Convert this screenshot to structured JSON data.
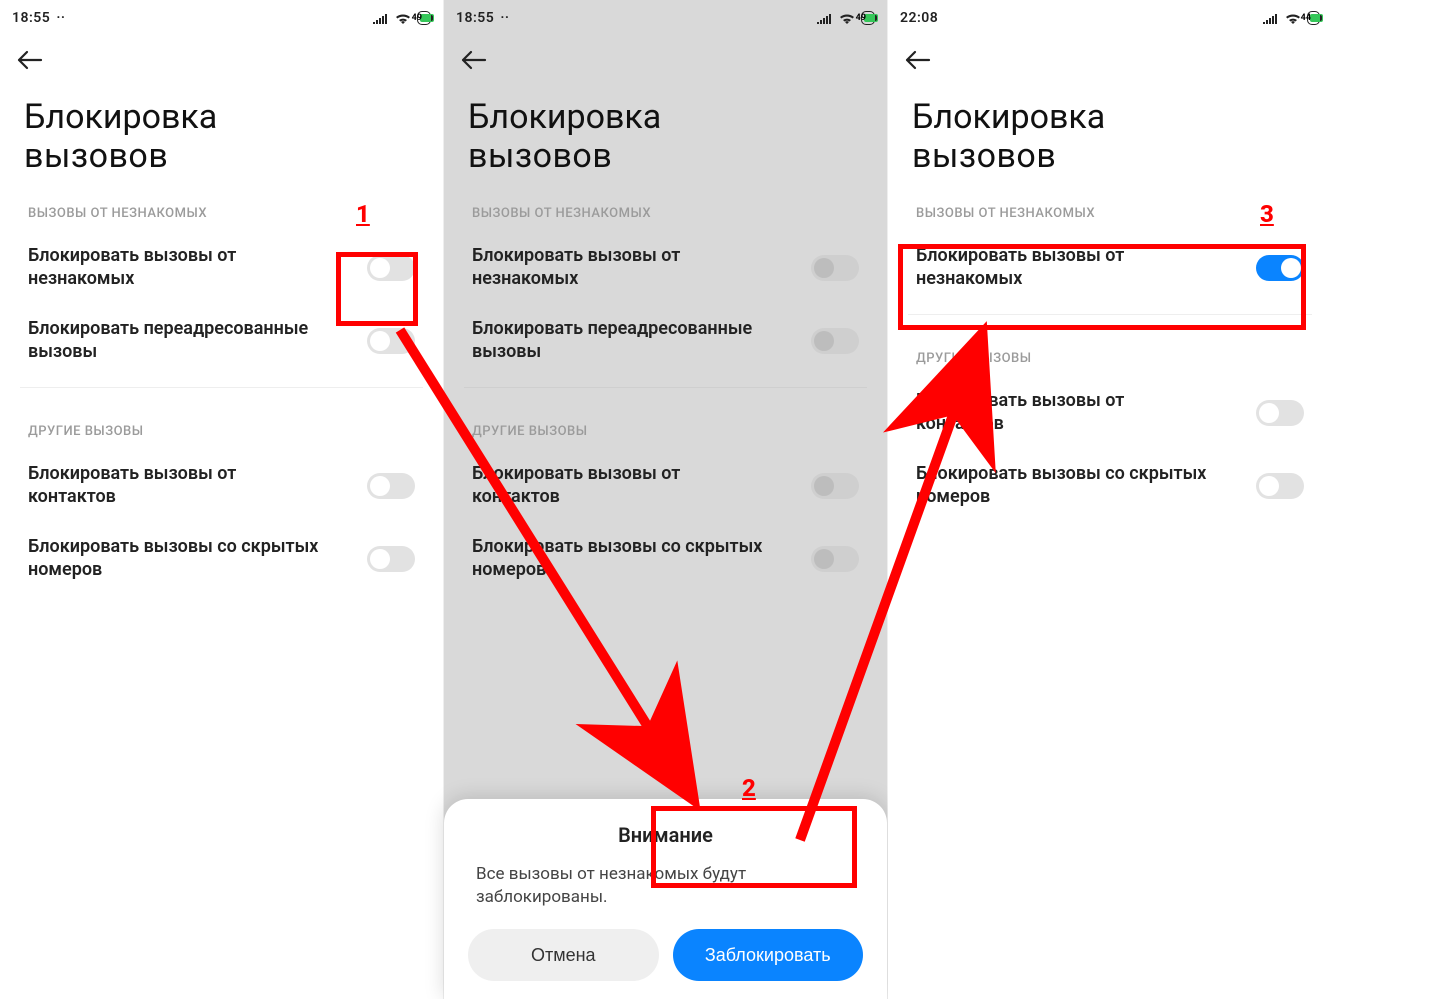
{
  "annotations": {
    "num1": "1",
    "num2": "2",
    "num3": "3",
    "color": "#ff0000"
  },
  "screen1": {
    "time": "18:55",
    "battery": "49",
    "title_line1": "Блокировка",
    "title_line2": "вызовов",
    "section1": "ВЫЗОВЫ ОТ НЕЗНАКОМЫХ",
    "opt1": "Блокировать вызовы от незнакомых",
    "opt2": "Блокировать переадресованные вызовы",
    "section2": "ДРУГИЕ ВЫЗОВЫ",
    "opt3": "Блокировать вызовы от контактов",
    "opt4": "Блокировать вызовы со скрытых номеров"
  },
  "screen2": {
    "time": "18:55",
    "battery": "49",
    "title_line1": "Блокировка",
    "title_line2": "вызовов",
    "section1": "ВЫЗОВЫ ОТ НЕЗНАКОМЫХ",
    "opt1": "Блокировать вызовы от незнакомых",
    "opt2": "Блокировать переадресованные вызовы",
    "section2": "ДРУГИЕ ВЫЗОВЫ",
    "opt3": "Блокировать вызовы от контактов",
    "opt4": "Блокировать вызовы со скрытых номеров",
    "dialog_title": "Внимание",
    "dialog_msg": "Все вызовы от незнакомых будут заблокированы.",
    "cancel": "Отмена",
    "confirm": "Заблокировать"
  },
  "screen3": {
    "time": "22:08",
    "battery": "44",
    "title_line1": "Блокировка",
    "title_line2": "вызовов",
    "section1": "ВЫЗОВЫ ОТ НЕЗНАКОМЫХ",
    "opt1": "Блокировать вызовы от незнакомых",
    "section2": "ДРУГИЕ ВЫЗОВЫ",
    "opt3": "Блокировать вызовы от контактов",
    "opt4": "Блокировать вызовы со скрытых номеров"
  }
}
